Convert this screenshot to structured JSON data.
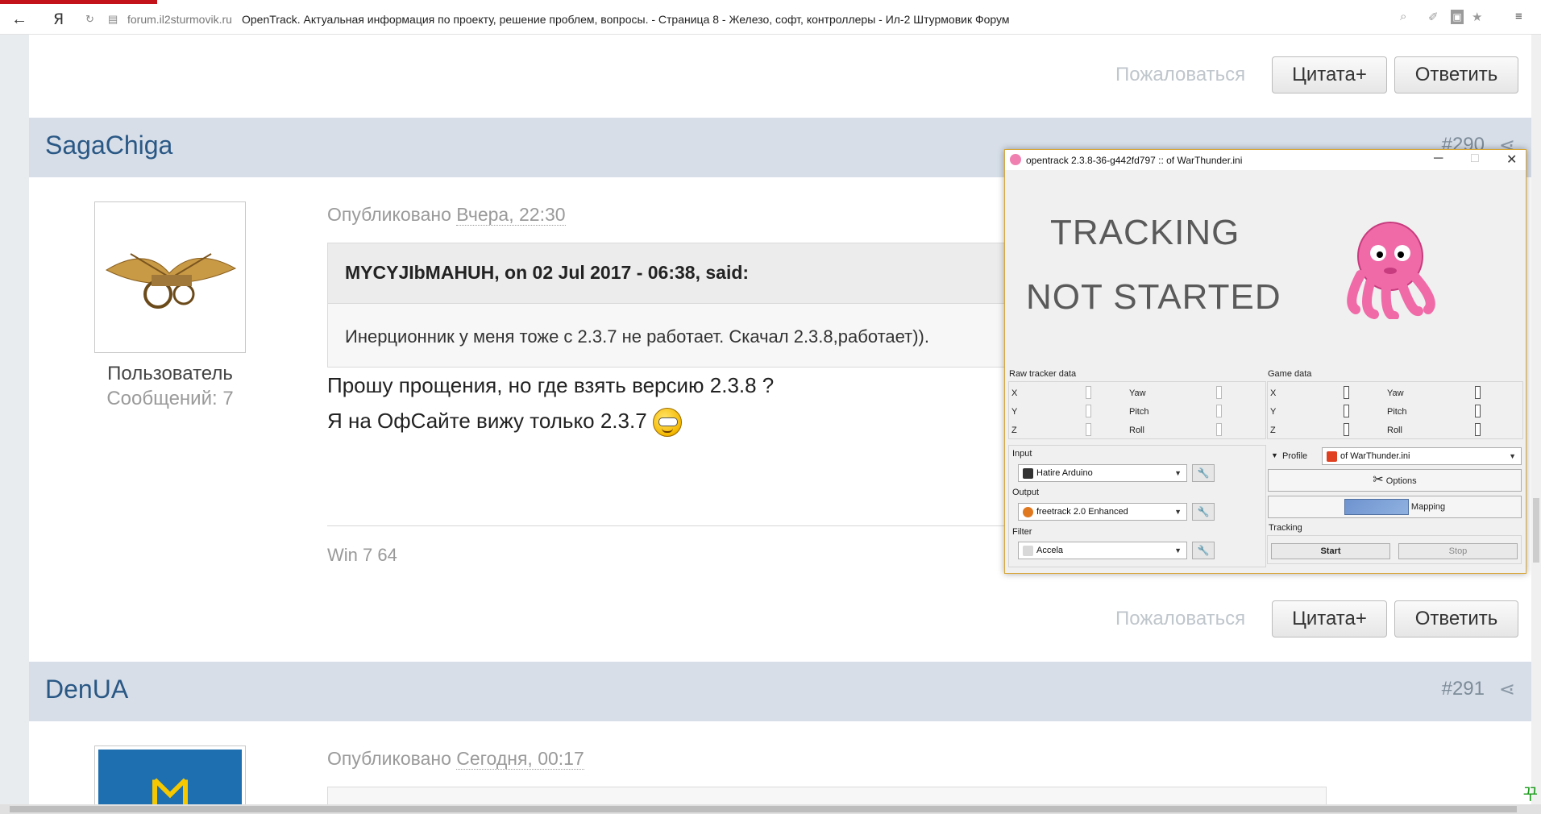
{
  "browser": {
    "logo": "Я",
    "domain": "forum.il2sturmovik.ru",
    "title": "OpenTrack. Актуальная информация по проекту, решение проблем, вопросы. - Страница 8 - Железо, софт, контроллеры - Ил-2 Штурмовик Форум"
  },
  "top_actions": {
    "report": "Пожаловаться",
    "quote": "Цитата+",
    "reply": "Ответить"
  },
  "post1": {
    "author": "SagaChiga",
    "number": "#290",
    "role": "Пользователь",
    "messages": "Сообщений: 7",
    "published_prefix": "Опубликовано",
    "published_time": "Вчера, 22:30",
    "quote_header": "MYCYJIbMAHUH, on 02 Jul 2017 - 06:38, said:",
    "quote_text": "Инерционник у меня тоже  с  2.3.7 не работает. Скачал 2.3.8,работает)).",
    "line1": "Прошу прощения, но где взять версию 2.3.8 ?",
    "line2": "Я на ОфСайте вижу только 2.3.7",
    "signature": "Win 7 64",
    "report": "Пожаловаться",
    "quote": "Цитата+",
    "reply": "Ответить"
  },
  "post2": {
    "author": "DenUA",
    "number": "#291",
    "published_prefix": "Опубликовано",
    "published_time": "Сегодня, 00:17"
  },
  "opentrack": {
    "title": "opentrack 2.3.8-36-g442fd797 :: of  WarThunder.ini",
    "status_line1": "TRACKING",
    "status_line2": "NOT STARTED",
    "raw_label": "Raw tracker data",
    "game_label": "Game data",
    "axes_left": [
      "X",
      "Y",
      "Z"
    ],
    "axes_right": [
      "Yaw",
      "Pitch",
      "Roll"
    ],
    "input_label": "Input",
    "input_value": "Hatire Arduino",
    "output_label": "Output",
    "output_value": "freetrack 2.0 Enhanced",
    "filter_label": "Filter",
    "filter_value": "Accela",
    "profile_label": "Profile",
    "profile_value": "of  WarThunder.ini",
    "options_label": "Options",
    "mapping_label": "Mapping",
    "tracking_label": "Tracking",
    "start_label": "Start",
    "stop_label": "Stop",
    "colors": {
      "frame": "#d8a73a",
      "octopus": "#f06aa8"
    }
  }
}
